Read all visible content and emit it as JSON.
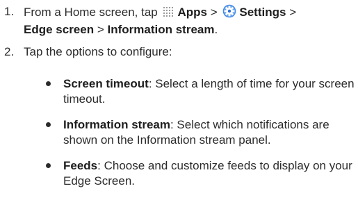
{
  "steps": [
    {
      "number": "1.",
      "intro": "From a Home screen, tap",
      "apps_label": "Apps",
      "sep1": ">",
      "settings_label": "Settings",
      "sep2": ">",
      "edge_label": "Edge screen",
      "sep3": ">",
      "stream_label": "Information stream",
      "end": "."
    },
    {
      "number": "2.",
      "text": "Tap the options to configure:"
    }
  ],
  "options": [
    {
      "term": "Screen timeout",
      "desc": ": Select a length of time for your screen timeout."
    },
    {
      "term": "Information stream",
      "desc": ": Select which notifications are shown on the Information stream panel."
    },
    {
      "term": "Feeds",
      "desc": ": Choose and customize feeds to display on your Edge Screen."
    }
  ],
  "icons": {
    "apps": "apps-grid-icon",
    "settings": "settings-gear-icon"
  },
  "colors": {
    "text": "#2b2b2b",
    "settings_icon": "#2f6fd6",
    "apps_icon": "#9a9a9a"
  }
}
